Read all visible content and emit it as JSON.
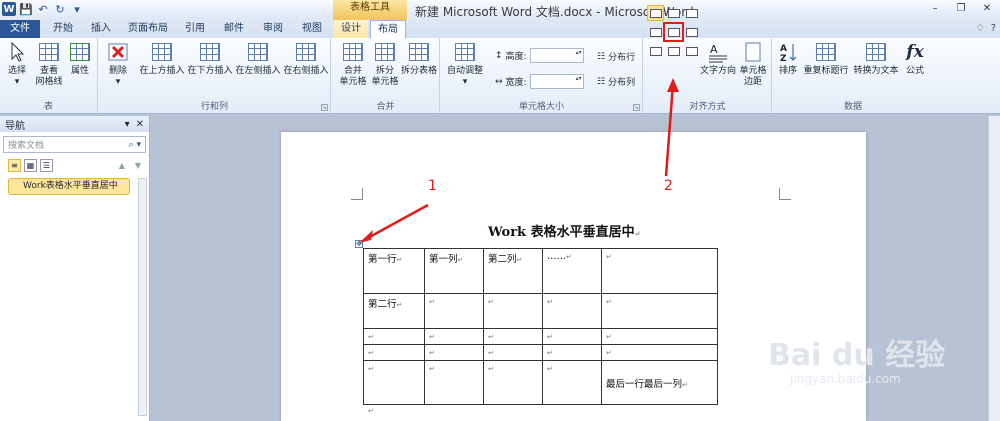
{
  "title_bar": {
    "context_tab_title": "表格工具",
    "window_title": "新建 Microsoft Word 文档.docx - Microsoft Word",
    "window_buttons": [
      "–",
      "❐",
      "✕"
    ]
  },
  "tabs": {
    "file": "文件",
    "home": "开始",
    "insert": "插入",
    "page_layout": "页面布局",
    "references": "引用",
    "mailings": "邮件",
    "review": "审阅",
    "view": "视图",
    "design": "设计",
    "layout": "布局",
    "right_icons": [
      "♢",
      "?"
    ]
  },
  "ribbon": {
    "table_group": {
      "label": "表",
      "select": "选择",
      "gridlines_line1": "查看",
      "gridlines_line2": "网格线",
      "properties": "属性"
    },
    "rows_cols_group": {
      "label": "行和列",
      "delete": "删除",
      "insert_above": "在上方插入",
      "insert_below": "在下方插入",
      "insert_left": "在左侧插入",
      "insert_right": "在右侧插入"
    },
    "merge_group": {
      "label": "合并",
      "merge_line1": "合并",
      "merge_line2": "单元格",
      "split_line1": "拆分",
      "split_line2": "单元格",
      "split_table": "拆分表格"
    },
    "cell_size_group": {
      "label": "单元格大小",
      "autofit": "自动调整",
      "height": "高度:",
      "width": "宽度:",
      "distribute_rows": "分布行",
      "distribute_cols": "分布列"
    },
    "alignment_group": {
      "label": "对齐方式",
      "text_direction": "文字方向",
      "cell_margins_line1": "单元格",
      "cell_margins_line2": "边距"
    },
    "data_group": {
      "label": "数据",
      "sort": "排序",
      "repeat_header": "重复标题行",
      "convert_to_text": "转换为文本",
      "formula": "公式"
    }
  },
  "nav_pane": {
    "title": "导航",
    "search_placeholder": "搜索文档",
    "heading_item": "Work表格水平垂直居中"
  },
  "document": {
    "title": "Work 表格水平垂直居中",
    "para_mark": "↵",
    "table_rows": [
      [
        "第一行",
        "第一列",
        "第二列",
        "……",
        ""
      ],
      [
        "第二行",
        "",
        "",
        "",
        ""
      ],
      [
        "",
        "",
        "",
        "",
        ""
      ],
      [
        "",
        "",
        "",
        "",
        ""
      ],
      [
        "",
        "",
        "",
        "",
        "最后一行最后一列"
      ]
    ]
  },
  "annotations": {
    "label_1": "1",
    "label_2": "2"
  },
  "watermark": {
    "brand": "Bai du 经验",
    "url": "jingyan.baidu.com"
  },
  "colors": {
    "file_tab": "#2b5797",
    "context_tab": "#f3c35b",
    "annotation_red": "#e21b1b",
    "selected_highlight": "#fce59b"
  }
}
